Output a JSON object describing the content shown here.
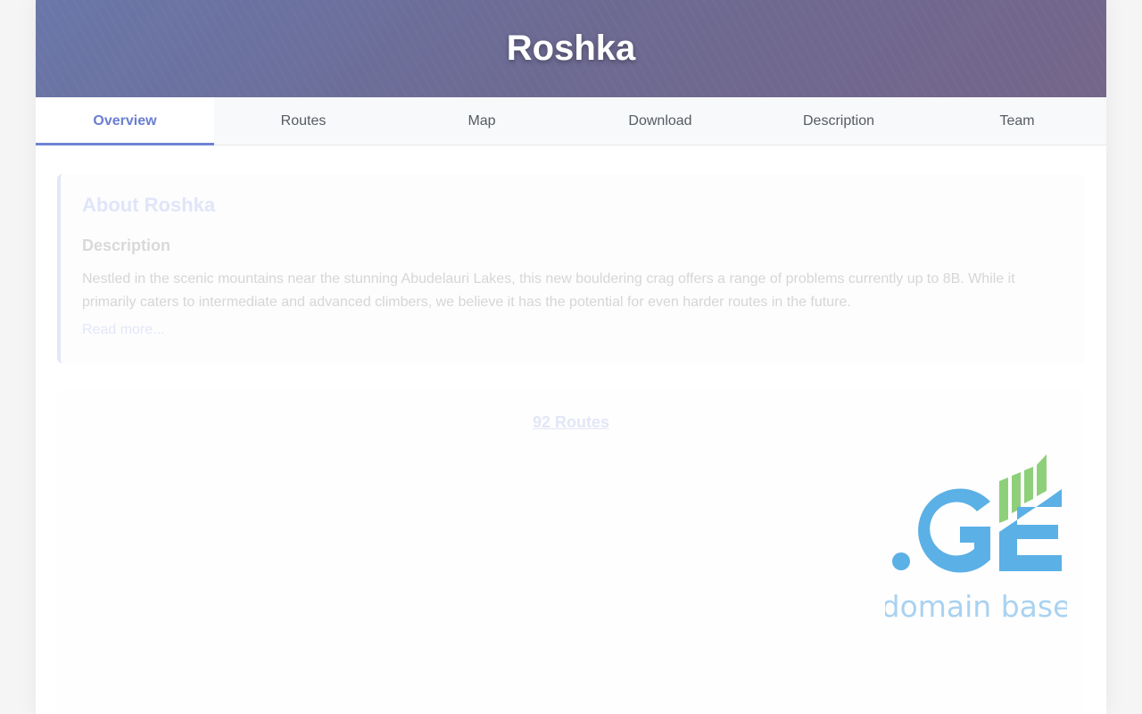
{
  "header": {
    "title": "Roshka"
  },
  "tabs": [
    {
      "label": "Overview",
      "active": true
    },
    {
      "label": "Routes",
      "active": false
    },
    {
      "label": "Map",
      "active": false
    },
    {
      "label": "Download",
      "active": false
    },
    {
      "label": "Description",
      "active": false
    },
    {
      "label": "Team",
      "active": false
    }
  ],
  "about": {
    "title": "About Roshka",
    "description_heading": "Description",
    "description_text": "Nestled in the scenic mountains near the stunning Abudelauri Lakes, this new bouldering crag offers a range of problems currently up to 8B. While it primarily caters to intermediate and advanced climbers, we believe it has the potential for even harder routes in the future.",
    "read_more": "Read more..."
  },
  "routes": {
    "count_label": "92 Routes"
  },
  "watermark": {
    "logo_text": ".GE",
    "tagline": "domain base",
    "colors": {
      "blue": "#5bb0e6",
      "green": "#8ed07a",
      "tagline": "#a9d2f1"
    }
  },
  "colors": {
    "accent": "#6f83d3",
    "hero_start": "#6a77a9",
    "hero_end": "#74658a"
  }
}
